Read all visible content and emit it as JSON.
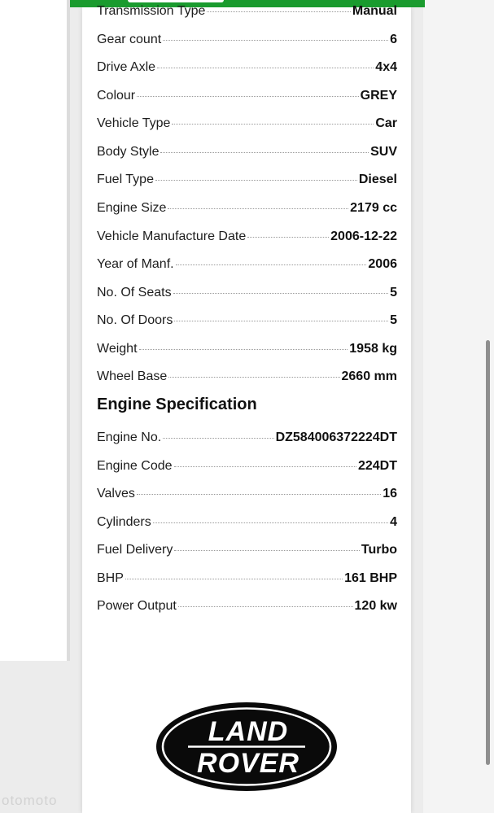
{
  "vehicle_details": [
    {
      "label": "Transmission Type",
      "value": "Manual"
    },
    {
      "label": "Gear count",
      "value": "6"
    },
    {
      "label": "Drive Axle",
      "value": "4x4"
    },
    {
      "label": "Colour",
      "value": "GREY"
    },
    {
      "label": "Vehicle Type",
      "value": "Car"
    },
    {
      "label": "Body Style",
      "value": "SUV"
    },
    {
      "label": "Fuel Type",
      "value": "Diesel"
    },
    {
      "label": "Engine Size",
      "value": "2179 cc"
    },
    {
      "label": "Vehicle Manufacture Date",
      "value": "2006-12-22"
    },
    {
      "label": "Year of Manf.",
      "value": "2006"
    },
    {
      "label": "No. Of Seats",
      "value": "5"
    },
    {
      "label": "No. Of Doors",
      "value": "5"
    },
    {
      "label": "Weight",
      "value": "1958 kg"
    },
    {
      "label": "Wheel Base",
      "value": "2660 mm"
    }
  ],
  "engine_section_title": "Engine Specification",
  "engine_details": [
    {
      "label": "Engine No.",
      "value": "DZ584006372224DT"
    },
    {
      "label": "Engine Code",
      "value": "224DT"
    },
    {
      "label": "Valves",
      "value": "16"
    },
    {
      "label": "Cylinders",
      "value": "4"
    },
    {
      "label": "Fuel Delivery",
      "value": "Turbo"
    },
    {
      "label": "BHP",
      "value": "161 BHP"
    },
    {
      "label": "Power Output",
      "value": "120 kw"
    }
  ],
  "logo": {
    "line1": "LAND",
    "line2": "ROVER"
  },
  "watermark": "otomoto",
  "colors": {
    "header_green": "#1a9b2e",
    "logo_black": "#0a0a0a"
  }
}
